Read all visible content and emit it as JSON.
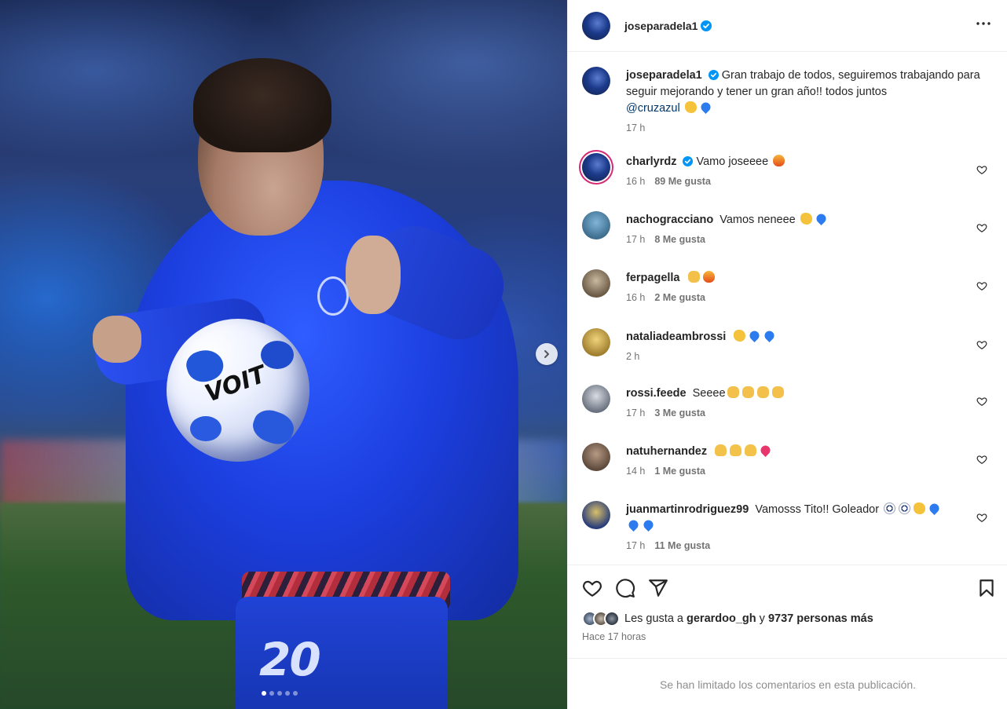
{
  "post": {
    "author": "joseparadela1",
    "more_icon": "more-horizontal-icon",
    "caption_text": "Gran trabajo de todos, seguiremos trabajando para seguir mejorando y tener un gran año!! todos juntos",
    "caption_mention": "@cruzazul",
    "caption_time": "17 h",
    "media_carousel": {
      "slides": 5,
      "current": 1
    }
  },
  "comments": [
    {
      "user": "charlyrdz",
      "verified": true,
      "text": "Vamo joseeee",
      "time": "16 h",
      "likes": "89 Me gusta"
    },
    {
      "user": "nachogracciano",
      "verified": false,
      "text": "Vamos neneee",
      "time": "17 h",
      "likes": "8 Me gusta"
    },
    {
      "user": "ferpagella",
      "verified": false,
      "text": "",
      "time": "16 h",
      "likes": "2 Me gusta"
    },
    {
      "user": "nataliadeambrossi",
      "verified": false,
      "text": "",
      "time": "2 h",
      "likes": ""
    },
    {
      "user": "rossi.feede",
      "verified": false,
      "text": "Seeee",
      "time": "17 h",
      "likes": "3 Me gusta"
    },
    {
      "user": "natuhernandez",
      "verified": false,
      "text": "",
      "time": "14 h",
      "likes": "1 Me gusta"
    },
    {
      "user": "juanmartinrodriguez99",
      "verified": false,
      "text": "Vamosss Tito!! Goleador",
      "time": "17 h",
      "likes": "11 Me gusta"
    }
  ],
  "actions": {
    "like_icon": "heart-icon",
    "comment_icon": "comment-icon",
    "share_icon": "send-icon",
    "save_icon": "bookmark-icon"
  },
  "likes_summary": {
    "prefix": "Les gusta a",
    "user": "gerardoo_gh",
    "joiner": "y",
    "others": "9737 personas más"
  },
  "posted_ago": "Hace 17 horas",
  "comments_limited": "Se han limitado los comentarios en esta publicación.",
  "colors": {
    "verified": "#0095f6",
    "mention": "#00376b",
    "muted": "#737373",
    "border": "#efefef"
  }
}
